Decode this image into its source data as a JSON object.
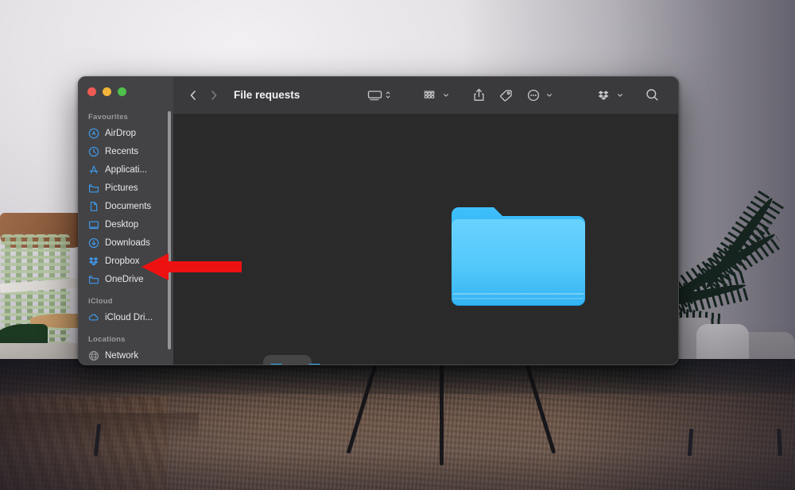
{
  "scene": {
    "description": "living-room-with-wall-mounted-tv",
    "colors": {
      "wall": "#e6e3e6",
      "floor_rug": "#a8835f",
      "sofa": "#9d9a9f",
      "plant": "#1c3a22",
      "tv_frame": "#1a1a1c"
    }
  },
  "window": {
    "title": "File requests",
    "traffic_lights": [
      {
        "name": "close-button",
        "color": "#f05b53"
      },
      {
        "name": "minimize-button",
        "color": "#f2b43a"
      },
      {
        "name": "maximize-button",
        "color": "#4ec04b"
      }
    ],
    "nav": {
      "back_label": "Back",
      "forward_label": "Forward"
    }
  },
  "toolbar": {
    "items": [
      {
        "icon": "view-group-icon",
        "label": "Group items",
        "has_chevron": true
      },
      {
        "icon": "icon-view-icon",
        "label": "View options",
        "has_chevron": true
      },
      {
        "icon": "share-icon",
        "label": "Share",
        "has_chevron": false
      },
      {
        "icon": "tag-icon",
        "label": "Tags",
        "has_chevron": false
      },
      {
        "icon": "more-actions-icon",
        "label": "More",
        "has_chevron": true
      },
      {
        "icon": "dropbox-icon",
        "label": "Dropbox",
        "has_chevron": true
      },
      {
        "icon": "search-icon",
        "label": "Search",
        "has_chevron": false
      }
    ]
  },
  "sidebar": {
    "sections": [
      {
        "header": "Favourites",
        "items": [
          {
            "label": "AirDrop",
            "icon": "airdrop-icon"
          },
          {
            "label": "Recents",
            "icon": "clock-icon"
          },
          {
            "label": "Applicati...",
            "icon": "applications-icon"
          },
          {
            "label": "Pictures",
            "icon": "folder-icon"
          },
          {
            "label": "Documents",
            "icon": "document-icon"
          },
          {
            "label": "Desktop",
            "icon": "desktop-icon"
          },
          {
            "label": "Downloads",
            "icon": "download-icon"
          },
          {
            "label": "Dropbox",
            "icon": "dropbox-icon"
          },
          {
            "label": "OneDrive",
            "icon": "folder-icon"
          }
        ]
      },
      {
        "header": "iCloud",
        "items": [
          {
            "label": "iCloud Dri...",
            "icon": "cloud-icon"
          }
        ]
      },
      {
        "header": "Locations",
        "items": [
          {
            "label": "Network",
            "icon": "network-icon"
          }
        ]
      }
    ]
  },
  "content": {
    "folders": [
      {
        "name": "large-folder-preview",
        "selected": false
      },
      {
        "name": "folder-thumbnail-1",
        "selected": true
      },
      {
        "name": "folder-thumbnail-2",
        "selected": false
      }
    ],
    "folder_color": "#3db9f5"
  },
  "annotation": {
    "type": "arrow",
    "color": "#ee1111",
    "points_to": "Dropbox"
  }
}
